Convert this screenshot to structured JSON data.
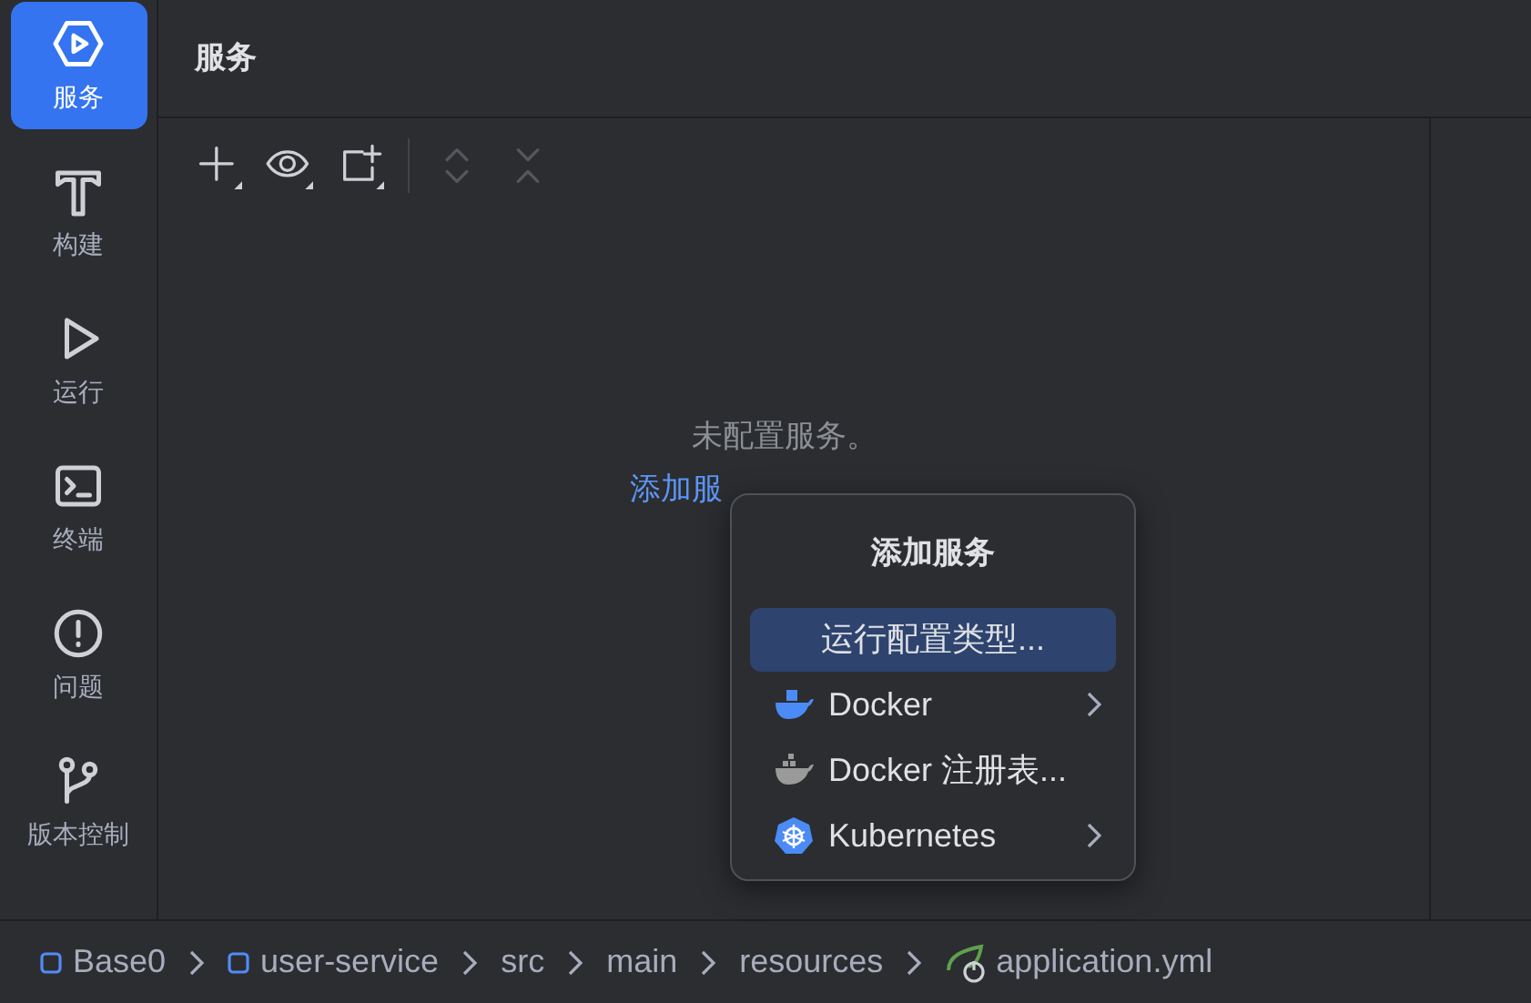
{
  "sidebar": {
    "items": [
      {
        "kind": "services",
        "label": "服务",
        "selected": true
      },
      {
        "kind": "build",
        "label": "构建",
        "selected": false
      },
      {
        "kind": "run",
        "label": "运行",
        "selected": false
      },
      {
        "kind": "terminal",
        "label": "终端",
        "selected": false
      },
      {
        "kind": "problems",
        "label": "问题",
        "selected": false
      },
      {
        "kind": "vcs",
        "label": "版本控制",
        "selected": false
      }
    ]
  },
  "panel": {
    "title": "服务",
    "toolbar": [
      {
        "kind": "add",
        "disabled": false
      },
      {
        "kind": "view",
        "disabled": false
      },
      {
        "kind": "new-group",
        "disabled": false
      },
      {
        "kind": "expand",
        "disabled": true
      },
      {
        "kind": "collapse",
        "disabled": true
      }
    ],
    "empty_message": "未配置服务。",
    "add_link": "添加服"
  },
  "popup": {
    "title": "添加服务",
    "items": [
      {
        "kind": "plain",
        "label": "运行配置类型...",
        "selected": true,
        "submenu": false
      },
      {
        "kind": "docker",
        "label": "Docker",
        "selected": false,
        "submenu": true
      },
      {
        "kind": "docker-registry",
        "label": "Docker 注册表...",
        "selected": false,
        "submenu": false
      },
      {
        "kind": "kubernetes",
        "label": "Kubernetes",
        "selected": false,
        "submenu": true
      }
    ]
  },
  "breadcrumbs": [
    {
      "kind": "module",
      "label": "Base0"
    },
    {
      "kind": "module",
      "label": "user-service"
    },
    {
      "kind": "folder",
      "label": "src"
    },
    {
      "kind": "folder",
      "label": "main"
    },
    {
      "kind": "folder",
      "label": "resources"
    },
    {
      "kind": "spring",
      "label": "application.yml"
    }
  ]
}
